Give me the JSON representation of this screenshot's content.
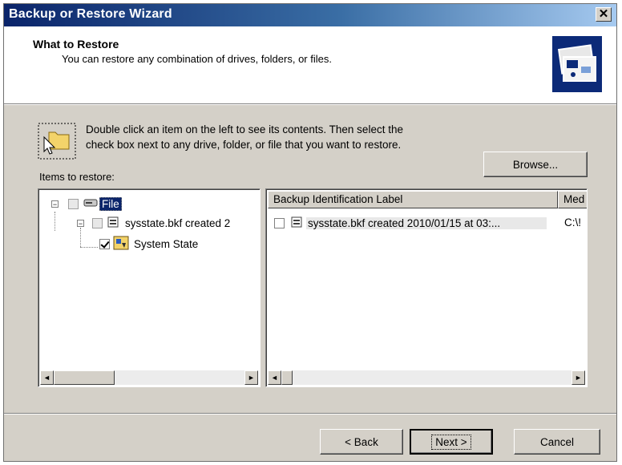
{
  "window": {
    "title": "Backup or Restore Wizard",
    "close_glyph": "✕"
  },
  "header": {
    "title": "What to Restore",
    "subtitle": "You can restore any combination of drives, folders, or files."
  },
  "hint": {
    "line1": "Double click an item on the left to see its contents. Then select the",
    "line2": "check box next to any drive, folder, or file that you want to restore."
  },
  "browse_button": {
    "label": "Browse...",
    "mnemonic": "r"
  },
  "items_label": {
    "text": "Items to restore:",
    "mnemonic": "m"
  },
  "tree": [
    {
      "label": "File",
      "icon": "drive-icon",
      "expander": "−",
      "checked": false,
      "selected": true
    },
    {
      "label": "sysstate.bkf created 2",
      "icon": "backup-file-icon",
      "expander": "−",
      "checked": false
    },
    {
      "label": "System State",
      "icon": "system-state-icon",
      "checked": true
    }
  ],
  "list": {
    "columns": [
      "Backup Identification Label",
      "Med"
    ],
    "rows": [
      {
        "label": "sysstate.bkf created 2010/01/15 at 03:...",
        "media": "C:\\!"
      }
    ]
  },
  "scroll": {
    "left_arrow": "◄",
    "right_arrow": "►"
  },
  "buttons": {
    "back": "< Back",
    "next": "Next >",
    "cancel": "Cancel"
  },
  "colors": {
    "title_bar": "#0a246a",
    "selection": "#0a246a",
    "face": "#d4d0c8"
  }
}
